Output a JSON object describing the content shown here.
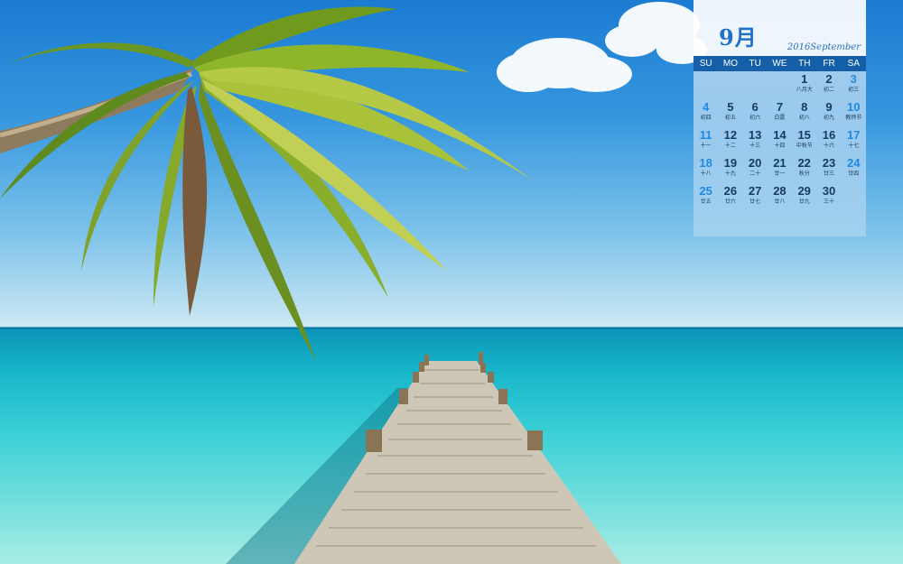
{
  "calendar": {
    "month_label": "9月",
    "year_month_label": "2016September",
    "weekdays": [
      "SU",
      "MO",
      "TU",
      "WE",
      "TH",
      "FR",
      "SA"
    ],
    "weeks": [
      [
        null,
        null,
        null,
        null,
        {
          "day": "1",
          "lunar": "八月大"
        },
        {
          "day": "2",
          "lunar": "初二"
        },
        {
          "day": "3",
          "lunar": "初三"
        }
      ],
      [
        {
          "day": "4",
          "lunar": "初四"
        },
        {
          "day": "5",
          "lunar": "初五"
        },
        {
          "day": "6",
          "lunar": "初六"
        },
        {
          "day": "7",
          "lunar": "白露"
        },
        {
          "day": "8",
          "lunar": "初八"
        },
        {
          "day": "9",
          "lunar": "初九"
        },
        {
          "day": "10",
          "lunar": "教师节"
        }
      ],
      [
        {
          "day": "11",
          "lunar": "十一"
        },
        {
          "day": "12",
          "lunar": "十二"
        },
        {
          "day": "13",
          "lunar": "十三"
        },
        {
          "day": "14",
          "lunar": "十四"
        },
        {
          "day": "15",
          "lunar": "中秋节"
        },
        {
          "day": "16",
          "lunar": "十六"
        },
        {
          "day": "17",
          "lunar": "十七"
        }
      ],
      [
        {
          "day": "18",
          "lunar": "十八"
        },
        {
          "day": "19",
          "lunar": "十九"
        },
        {
          "day": "20",
          "lunar": "二十"
        },
        {
          "day": "21",
          "lunar": "廿一"
        },
        {
          "day": "22",
          "lunar": "秋分"
        },
        {
          "day": "23",
          "lunar": "廿三"
        },
        {
          "day": "24",
          "lunar": "廿四"
        }
      ],
      [
        {
          "day": "25",
          "lunar": "廿五"
        },
        {
          "day": "26",
          "lunar": "廿六"
        },
        {
          "day": "27",
          "lunar": "廿七"
        },
        {
          "day": "28",
          "lunar": "廿八"
        },
        {
          "day": "29",
          "lunar": "廿九"
        },
        {
          "day": "30",
          "lunar": "三十"
        },
        null
      ]
    ]
  },
  "colors": {
    "header_bar": "#155fa8",
    "weekend_number": "#2389e0",
    "weekday_number": "#173b63",
    "sea": "#2fc8d4",
    "sky": "#2a8ede"
  }
}
